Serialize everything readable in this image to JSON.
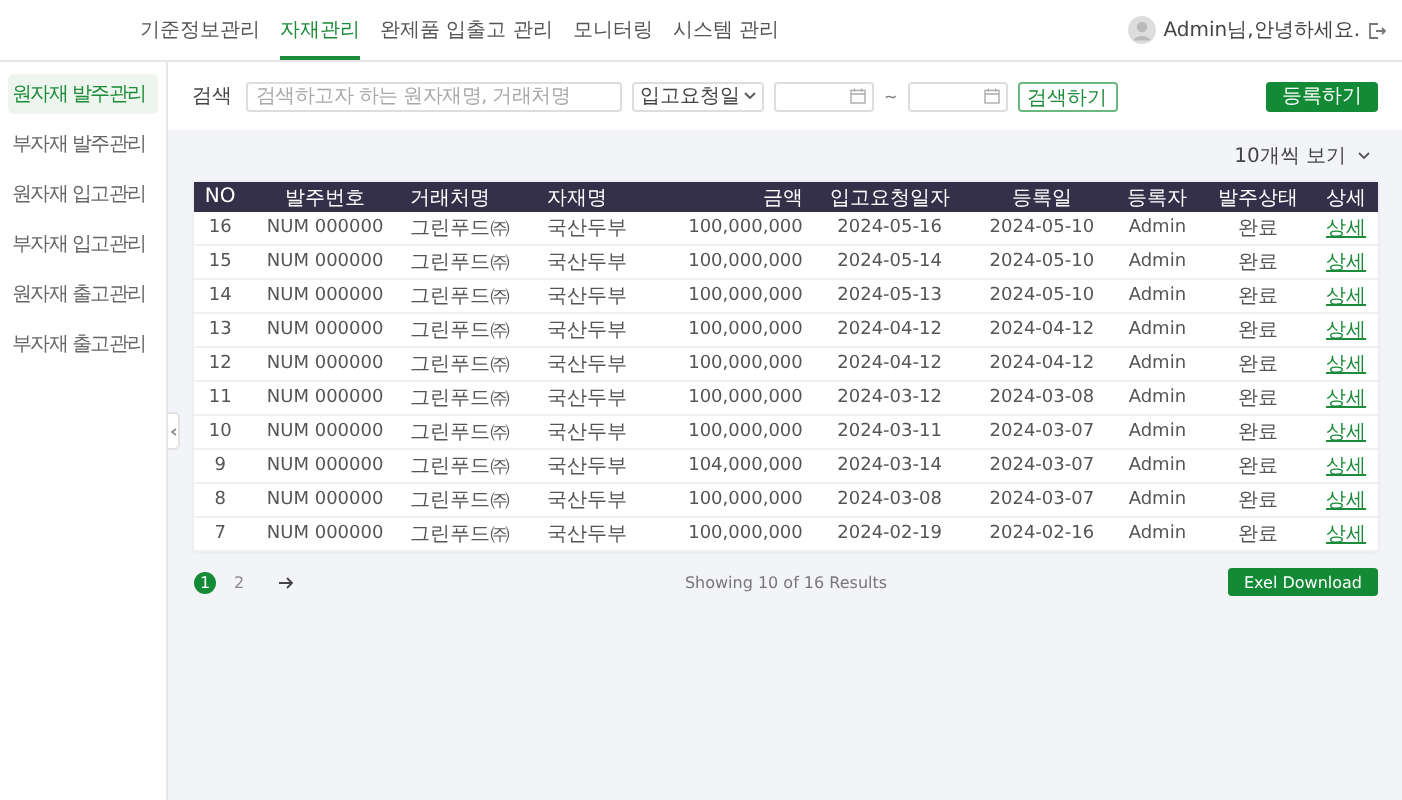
{
  "nav": {
    "tabs": [
      {
        "label": "기준정보관리",
        "selected": false
      },
      {
        "label": "자재관리",
        "selected": true
      },
      {
        "label": "완제품 입출고 관리",
        "selected": false
      },
      {
        "label": "모니터링",
        "selected": false
      },
      {
        "label": "시스템 관리",
        "selected": false
      }
    ],
    "user": "Admin님,안녕하세요."
  },
  "sidebar": {
    "items": [
      {
        "label": "원자재 발주관리",
        "selected": true
      },
      {
        "label": "부자재 발주관리",
        "selected": false
      },
      {
        "label": "원자재 입고관리",
        "selected": false
      },
      {
        "label": "부자재 입고관리",
        "selected": false
      },
      {
        "label": "원자재 출고관리",
        "selected": false
      },
      {
        "label": "부자재 출고관리",
        "selected": false
      }
    ]
  },
  "filter": {
    "label": "검색",
    "placeholder": "검색하고자 하는 원자재명, 거래처명",
    "date_type": "입고요청일",
    "range_sep": "~",
    "search_button": "검색하기",
    "register_button": "등록하기"
  },
  "page_size": "10개씩 보기",
  "table": {
    "columns": [
      "NO",
      "발주번호",
      "거래처명",
      "자재명",
      "금액",
      "입고요청일자",
      "등록일",
      "등록자",
      "발주상태",
      "상세"
    ],
    "rows": [
      [
        "16",
        "NUM 000000",
        "그린푸드㈜",
        "국산두부",
        "100,000,000",
        "2024-05-16",
        "2024-05-10",
        "Admin",
        "완료",
        "상세"
      ],
      [
        "15",
        "NUM 000000",
        "그린푸드㈜",
        "국산두부",
        "100,000,000",
        "2024-05-14",
        "2024-05-10",
        "Admin",
        "완료",
        "상세"
      ],
      [
        "14",
        "NUM 000000",
        "그린푸드㈜",
        "국산두부",
        "100,000,000",
        "2024-05-13",
        "2024-05-10",
        "Admin",
        "완료",
        "상세"
      ],
      [
        "13",
        "NUM 000000",
        "그린푸드㈜",
        "국산두부",
        "100,000,000",
        "2024-04-12",
        "2024-04-12",
        "Admin",
        "완료",
        "상세"
      ],
      [
        "12",
        "NUM 000000",
        "그린푸드㈜",
        "국산두부",
        "100,000,000",
        "2024-04-12",
        "2024-04-12",
        "Admin",
        "완료",
        "상세"
      ],
      [
        "11",
        "NUM 000000",
        "그린푸드㈜",
        "국산두부",
        "100,000,000",
        "2024-03-12",
        "2024-03-08",
        "Admin",
        "완료",
        "상세"
      ],
      [
        "10",
        "NUM 000000",
        "그린푸드㈜",
        "국산두부",
        "100,000,000",
        "2024-03-11",
        "2024-03-07",
        "Admin",
        "완료",
        "상세"
      ],
      [
        "9",
        "NUM 000000",
        "그린푸드㈜",
        "국산두부",
        "104,000,000",
        "2024-03-14",
        "2024-03-07",
        "Admin",
        "완료",
        "상세"
      ],
      [
        "8",
        "NUM 000000",
        "그린푸드㈜",
        "국산두부",
        "100,000,000",
        "2024-03-08",
        "2024-03-07",
        "Admin",
        "완료",
        "상세"
      ],
      [
        "7",
        "NUM 000000",
        "그린푸드㈜",
        "국산두부",
        "100,000,000",
        "2024-02-19",
        "2024-02-16",
        "Admin",
        "완료",
        "상세"
      ]
    ]
  },
  "pagination": {
    "pages": [
      {
        "label": "1",
        "selected": true
      },
      {
        "label": "2",
        "selected": false
      }
    ]
  },
  "summary": "Showing 10 of 16 Results",
  "export_button": "Exel Download"
}
